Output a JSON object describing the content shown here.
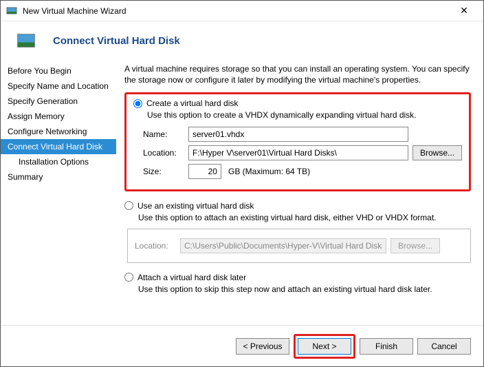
{
  "titlebar": {
    "title": "New Virtual Machine Wizard"
  },
  "header": {
    "title": "Connect Virtual Hard Disk"
  },
  "sidebar": {
    "items": [
      "Before You Begin",
      "Specify Name and Location",
      "Specify Generation",
      "Assign Memory",
      "Configure Networking",
      "Connect Virtual Hard Disk",
      "Installation Options",
      "Summary"
    ]
  },
  "content": {
    "intro": "A virtual machine requires storage so that you can install an operating system. You can specify the storage now or configure it later by modifying the virtual machine's properties.",
    "opt1": {
      "label": "Create a virtual hard disk",
      "desc": "Use this option to create a VHDX dynamically expanding virtual hard disk.",
      "name_label": "Name:",
      "name_value": "server01.vhdx",
      "location_label": "Location:",
      "location_value": "F:\\Hyper V\\server01\\Virtual Hard Disks\\",
      "browse": "Browse...",
      "size_label": "Size:",
      "size_value": "20",
      "size_unit": "GB (Maximum: 64 TB)"
    },
    "opt2": {
      "label": "Use an existing virtual hard disk",
      "desc": "Use this option to attach an existing virtual hard disk, either VHD or VHDX format.",
      "location_label": "Location:",
      "location_value": "C:\\Users\\Public\\Documents\\Hyper-V\\Virtual Hard Disks\\",
      "browse": "Browse..."
    },
    "opt3": {
      "label": "Attach a virtual hard disk later",
      "desc": "Use this option to skip this step now and attach an existing virtual hard disk later."
    }
  },
  "footer": {
    "previous": "< Previous",
    "next": "Next >",
    "finish": "Finish",
    "cancel": "Cancel"
  }
}
